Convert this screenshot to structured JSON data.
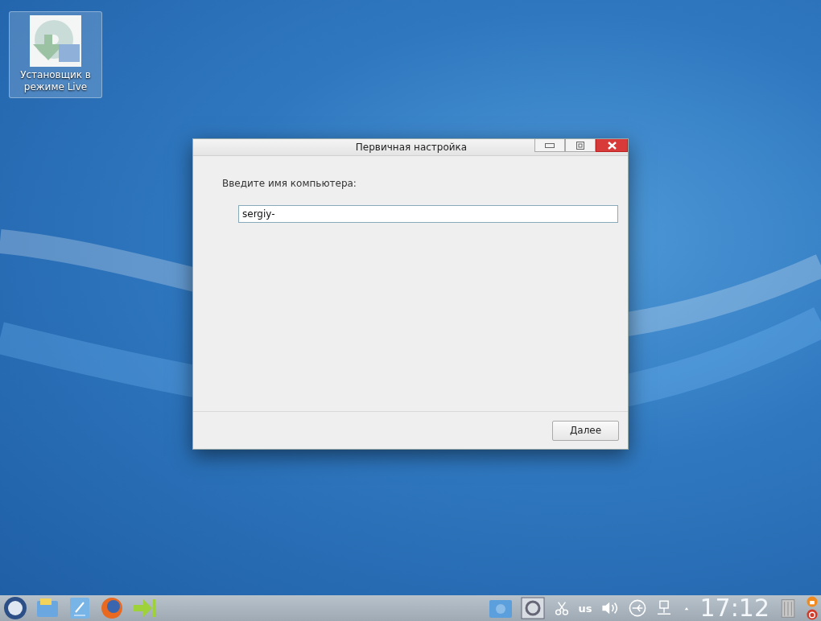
{
  "desktop_icons": [
    {
      "label": "Установщик в режиме Live"
    }
  ],
  "dialog": {
    "title": "Первичная настройка",
    "prompt": "Введите имя компьютера:",
    "hostname_field": {
      "value": "sergiy-"
    },
    "next_button": "Далее"
  },
  "taskbar": {
    "keyboard_layout": "us",
    "clock": "17:12"
  }
}
